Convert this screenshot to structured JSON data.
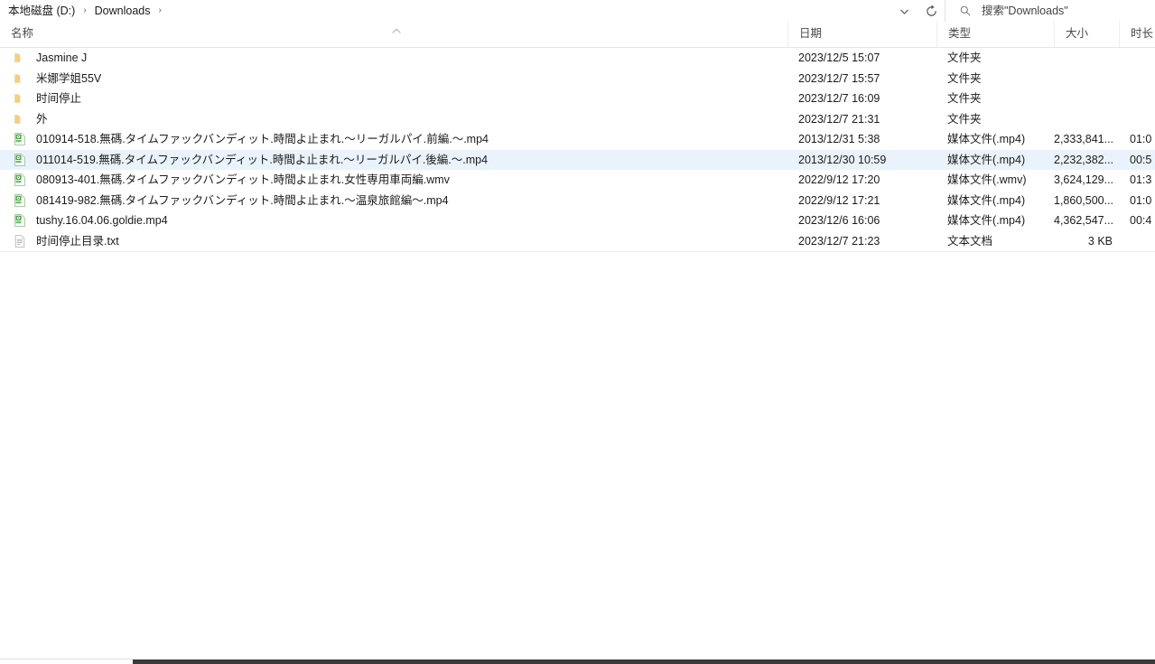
{
  "addressbar": {
    "breadcrumbs": [
      {
        "label": "本地磁盘 (D:)"
      },
      {
        "label": "Downloads"
      }
    ],
    "separator": "›",
    "history_dropdown_icon": "chevron-down-icon",
    "refresh_icon": "refresh-icon"
  },
  "search": {
    "icon": "search-icon",
    "placeholder": "搜索\"Downloads\""
  },
  "columns": [
    {
      "key": "name",
      "label": "名称",
      "sorted": "ascending"
    },
    {
      "key": "date",
      "label": "日期"
    },
    {
      "key": "type",
      "label": "类型"
    },
    {
      "key": "size",
      "label": "大小"
    },
    {
      "key": "duration",
      "label": "时长"
    }
  ],
  "rows": [
    {
      "icon": "folder-icon",
      "name": "Jasmine J",
      "date": "2023/12/5 15:07",
      "type": "文件夹",
      "size": "",
      "duration": "",
      "selected": false
    },
    {
      "icon": "folder-icon",
      "name": "米娜学姐55V",
      "date": "2023/12/7 15:57",
      "type": "文件夹",
      "size": "",
      "duration": "",
      "selected": false
    },
    {
      "icon": "folder-icon",
      "name": "时间停止",
      "date": "2023/12/7 16:09",
      "type": "文件夹",
      "size": "",
      "duration": "",
      "selected": false
    },
    {
      "icon": "folder-icon",
      "name": "外",
      "date": "2023/12/7 21:31",
      "type": "文件夹",
      "size": "",
      "duration": "",
      "selected": false
    },
    {
      "icon": "media-file-icon",
      "name": "010914-518.無碼.タイムファックバンディット.時間よ止まれ.～リーガルパイ.前編.～.mp4",
      "date": "2013/12/31 5:38",
      "type": "媒体文件(.mp4)",
      "size": "2,333,841...",
      "duration": "01:0",
      "selected": false
    },
    {
      "icon": "media-file-icon",
      "name": "011014-519.無碼.タイムファックバンディット.時間よ止まれ.～リーガルパイ.後編.～.mp4",
      "date": "2013/12/30 10:59",
      "type": "媒体文件(.mp4)",
      "size": "2,232,382...",
      "duration": "00:5",
      "selected": true
    },
    {
      "icon": "media-file-icon",
      "name": "080913-401.無碼.タイムファックバンディット.時間よ止まれ.女性専用車両編.wmv",
      "date": "2022/9/12 17:20",
      "type": "媒体文件(.wmv)",
      "size": "3,624,129...",
      "duration": "01:3",
      "selected": false
    },
    {
      "icon": "media-file-icon",
      "name": "081419-982.無碼.タイムファックバンディット.時間よ止まれ.～温泉旅館編～.mp4",
      "date": "2022/9/12 17:21",
      "type": "媒体文件(.mp4)",
      "size": "1,860,500...",
      "duration": "01:0",
      "selected": false
    },
    {
      "icon": "media-file-icon",
      "name": "tushy.16.04.06.goldie.mp4",
      "date": "2023/12/6 16:06",
      "type": "媒体文件(.mp4)",
      "size": "4,362,547...",
      "duration": "00:4",
      "selected": false
    },
    {
      "icon": "text-file-icon",
      "name": "时间停止目录.txt",
      "date": "2023/12/7 21:23",
      "type": "文本文档",
      "size": "3 KB",
      "duration": "",
      "selected": false
    }
  ],
  "colors": {
    "selection": "#eaf3fb",
    "folder": "#f7d486",
    "media_accent": "#3a9a3a",
    "text": "#1b1b1b",
    "header_text": "#4a4a4a",
    "taskbar": "#3a3a3a"
  }
}
